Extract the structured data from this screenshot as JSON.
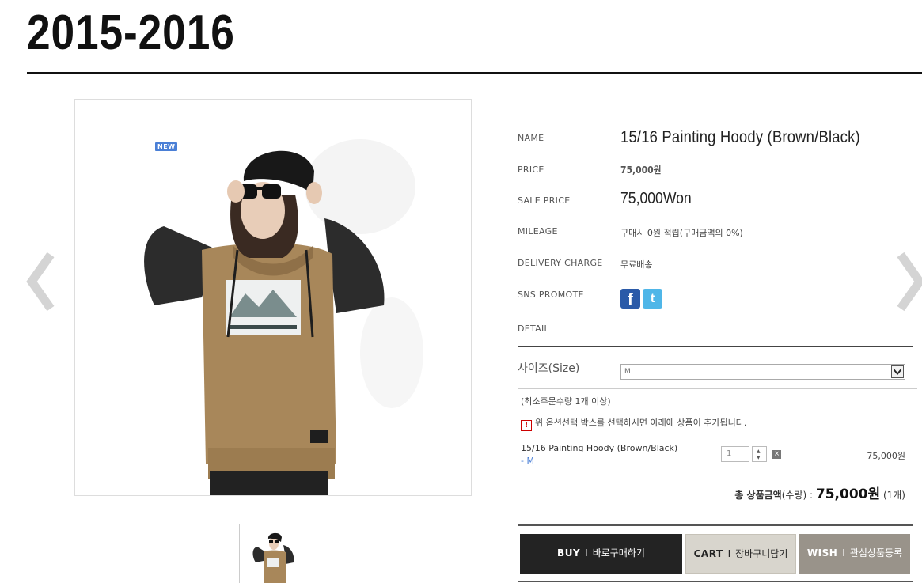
{
  "header": {
    "title": "2015-2016"
  },
  "product": {
    "badge": "NEW",
    "fields": {
      "name_label": "NAME",
      "name": "15/16 Painting Hoody (Brown/Black)",
      "price_label": "PRICE",
      "price": "75,000원",
      "sale_label": "SALE PRICE",
      "sale_price": "75,000Won",
      "mileage_label": "MILEAGE",
      "mileage": "구매시 0원 적립(구매금액의 0%)",
      "delivery_label": "DELIVERY CHARGE",
      "delivery": "무료배송",
      "sns_label": "SNS PROMOTE",
      "detail_label": "DETAIL"
    },
    "sns": {
      "facebook_icon": "facebook-icon",
      "twitter_icon": "twitter-icon"
    }
  },
  "options": {
    "size_label": "사이즈(Size)",
    "size_selected": "M",
    "min_qty_note": "(최소주문수량 1개 이상)",
    "notice_mark": "!",
    "notice": "위 옵션선택 박스를 선택하시면 아래에 상품이 추가됩니다.",
    "selected": {
      "name": "15/16 Painting Hoody (Brown/Black)",
      "option": "- M",
      "qty": "1",
      "delete": "×",
      "price": "75,000원"
    },
    "total": {
      "label_bold": "총 상품금액",
      "label_paren": "(수량) :",
      "amount": "75,000원",
      "count": "(1개)"
    }
  },
  "buttons": {
    "buy_en": "BUY",
    "buy_ko": "바로구매하기",
    "cart_en": "CART",
    "cart_ko": "장바구니담기",
    "wish_en": "WISH",
    "wish_ko": "관심상품등록",
    "sep": "I"
  },
  "colors": {
    "buy_bg": "#232323",
    "cart_bg": "#d8d5cd",
    "wish_bg": "#99938a",
    "new_badge": "#4a7fd6",
    "facebook": "#2a5aa8",
    "twitter": "#4fb6e8"
  }
}
